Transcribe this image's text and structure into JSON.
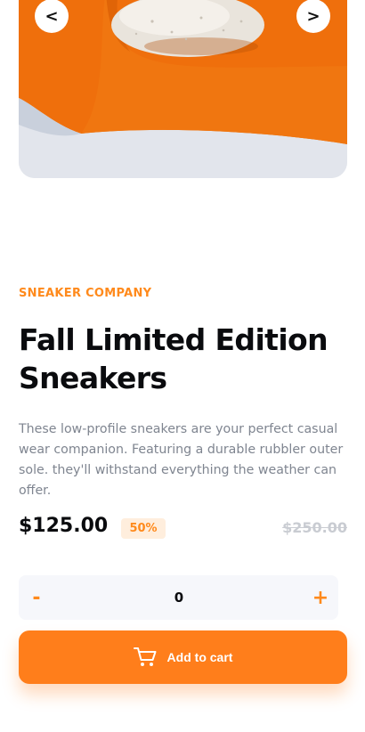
{
  "gallery": {
    "prev_label": "<",
    "next_label": ">"
  },
  "product": {
    "company": "SNEAKER COMPANY",
    "title": "Fall Limited Edition Sneakers",
    "description": "These low-profile sneakers are your perfect casual wear companion. Featuring a durable rubbler outer sole. they'll withstand everything the weather can offer.",
    "price": "$125.00",
    "discount": "50%",
    "original_price": "$250.00"
  },
  "quantity": {
    "decrement_label": "-",
    "value": "0",
    "increment_label": "+"
  },
  "cart": {
    "label": "Add to cart",
    "icon": "cart-icon"
  },
  "colors": {
    "accent": "#ff7e1b",
    "accent_pale": "#ffeedd",
    "text_dark": "#0a0b0e",
    "text_muted": "#7f8590"
  }
}
